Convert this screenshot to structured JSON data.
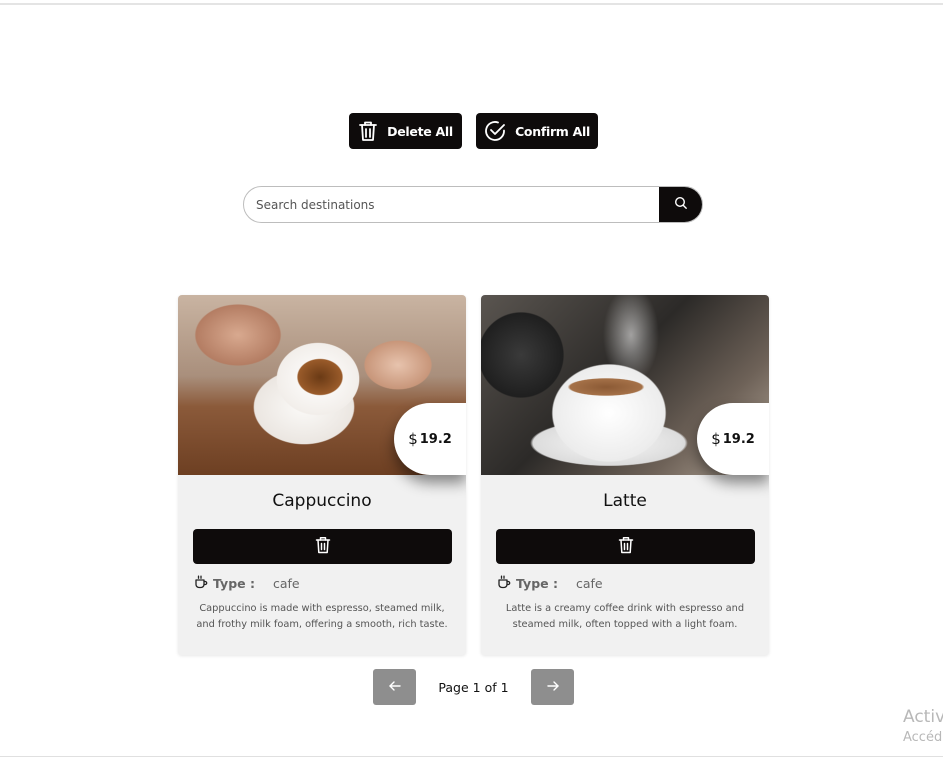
{
  "toolbar": {
    "delete_all_label": "Delete All",
    "delete_all_icon": "trash-icon",
    "confirm_all_label": "Confirm All",
    "confirm_all_icon": "check-circle-icon"
  },
  "search": {
    "placeholder": "Search destinations",
    "value": "",
    "button_icon": "search-icon"
  },
  "cards": [
    {
      "name": "Cappuccino",
      "price_currency": "$",
      "price": "19.2",
      "image": "cappuccino-photo",
      "type_label": "Type :",
      "type_value": "cafe",
      "type_icon": "coffee-cup-icon",
      "delete_icon": "trash-icon",
      "description": "Cappuccino is made with espresso, steamed milk, and frothy milk foam, offering a smooth, rich taste."
    },
    {
      "name": "Latte",
      "price_currency": "$",
      "price": "19.2",
      "image": "latte-photo",
      "type_label": "Type :",
      "type_value": "cafe",
      "type_icon": "coffee-cup-icon",
      "delete_icon": "trash-icon",
      "description": "Latte is a creamy coffee drink with espresso and steamed milk, often topped with a light foam."
    }
  ],
  "pagination": {
    "label": "Page 1 of 1",
    "prev_icon": "arrow-left-icon",
    "next_icon": "arrow-right-icon"
  },
  "watermark": {
    "line1": "Activ",
    "line2": "Accéd"
  },
  "colors": {
    "button_bg": "#0e0b0b",
    "card_bg": "#f1f1f1",
    "pager_bg": "#8e8e8e"
  }
}
